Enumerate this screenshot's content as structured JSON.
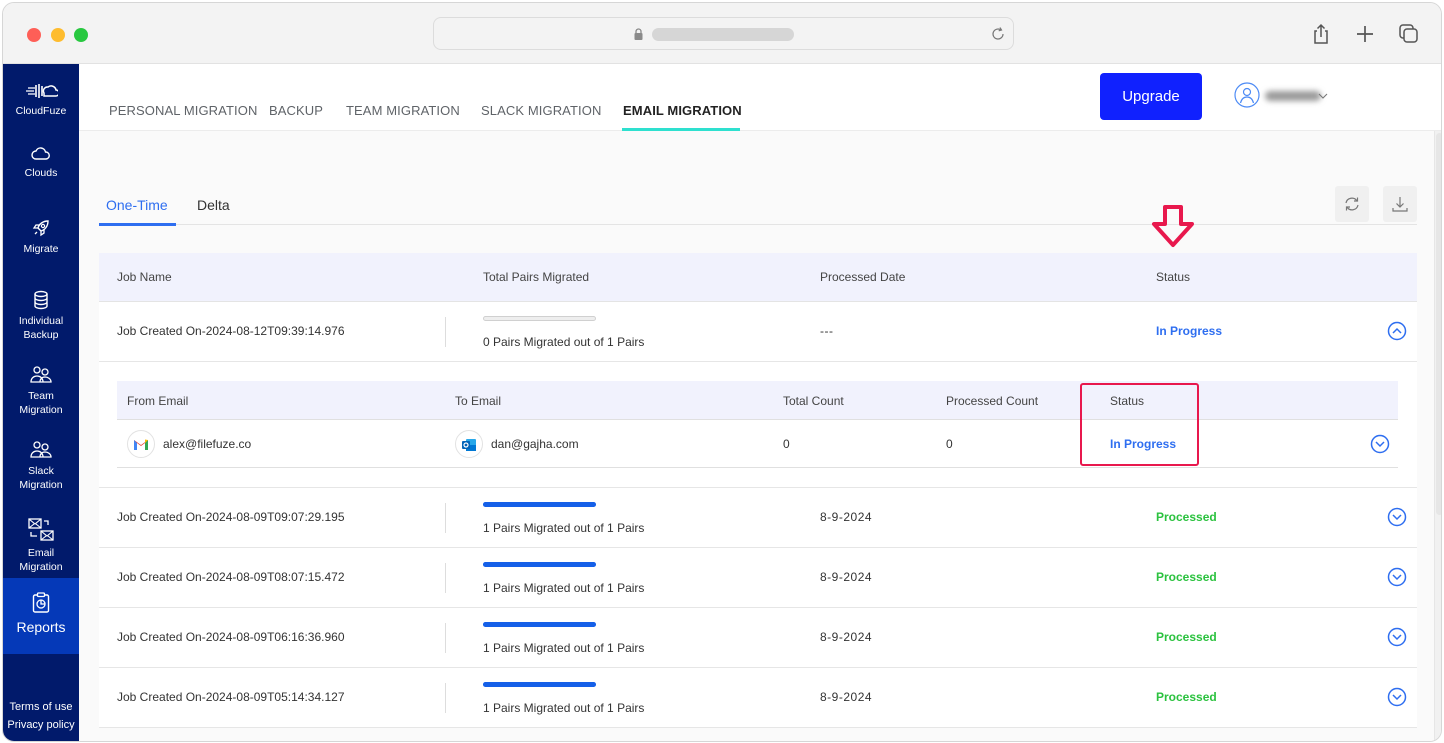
{
  "browser": {
    "traffic_lights": [
      "close",
      "minimize",
      "zoom"
    ],
    "icons": [
      "lock-icon",
      "reload-icon",
      "share-icon",
      "new-tab-icon",
      "tabs-overview-icon"
    ]
  },
  "sidebar": {
    "brand": "CloudFuze",
    "items": [
      {
        "label": "Clouds",
        "icon": "cloud-icon"
      },
      {
        "label": "Migrate",
        "icon": "rocket-icon"
      },
      {
        "label": "Individual Backup",
        "line1": "Individual",
        "line2": "Backup",
        "icon": "database-icon"
      },
      {
        "label": "Team Migration",
        "line1": "Team",
        "line2": "Migration",
        "icon": "users-icon"
      },
      {
        "label": "Slack Migration",
        "line1": "Slack",
        "line2": "Migration",
        "icon": "users-icon"
      },
      {
        "label": "Email Migration",
        "line1": "Email",
        "line2": "Migration",
        "icon": "email-swap-icon"
      },
      {
        "label": "Reports",
        "icon": "clipboard-chart-icon",
        "active": true
      }
    ],
    "footer": {
      "terms": "Terms of use",
      "privacy": "Privacy policy"
    }
  },
  "topnav": {
    "tabs": [
      {
        "label": "PERSONAL MIGRATION"
      },
      {
        "label": "BACKUP"
      },
      {
        "label": "TEAM MIGRATION"
      },
      {
        "label": "SLACK MIGRATION"
      },
      {
        "label": "EMAIL MIGRATION",
        "active": true
      }
    ],
    "upgrade_label": "Upgrade",
    "accent_color": "#2ee0cf"
  },
  "subtabs": [
    {
      "label": "One-Time",
      "active": true
    },
    {
      "label": "Delta"
    }
  ],
  "toolbar": {
    "refresh_icon": "refresh-icon",
    "download_icon": "download-icon"
  },
  "table": {
    "headers": {
      "job_name": "Job Name",
      "total_pairs": "Total Pairs Migrated",
      "processed_date": "Processed Date",
      "status": "Status"
    },
    "rows": [
      {
        "job_name": "Job Created On-2024-08-12T09:39:14.976",
        "pairs_text": "0 Pairs Migrated out of 1 Pairs",
        "progress": 0,
        "date": "---",
        "status": "In Progress",
        "expanded": true
      },
      {
        "job_name": "Job Created On-2024-08-09T09:07:29.195",
        "pairs_text": "1 Pairs Migrated out of 1 Pairs",
        "progress": 1,
        "date": "8-9-2024",
        "status": "Processed"
      },
      {
        "job_name": "Job Created On-2024-08-09T08:07:15.472",
        "pairs_text": "1 Pairs Migrated out of 1 Pairs",
        "progress": 1,
        "date": "8-9-2024",
        "status": "Processed"
      },
      {
        "job_name": "Job Created On-2024-08-09T06:16:36.960",
        "pairs_text": "1 Pairs Migrated out of 1 Pairs",
        "progress": 1,
        "date": "8-9-2024",
        "status": "Processed"
      },
      {
        "job_name": "Job Created On-2024-08-09T05:14:34.127",
        "pairs_text": "1 Pairs Migrated out of 1 Pairs",
        "progress": 1,
        "date": "8-9-2024",
        "status": "Processed"
      }
    ],
    "detail": {
      "headers": {
        "from": "From Email",
        "to": "To Email",
        "total": "Total Count",
        "processed": "Processed Count",
        "status": "Status"
      },
      "rows": [
        {
          "from": "alex@filefuze.co",
          "from_icon": "gmail-icon",
          "to": "dan@gajha.com",
          "to_icon": "outlook-icon",
          "total": "0",
          "processed": "0",
          "status": "In Progress"
        }
      ]
    }
  },
  "colors": {
    "sidebar_bg": "#011a6b",
    "sidebar_active": "#0539b8",
    "upgrade_button": "#1021fe",
    "link_blue": "#2e6ef0",
    "processed_green": "#2bc23f",
    "annotation_red": "#e8184d"
  }
}
